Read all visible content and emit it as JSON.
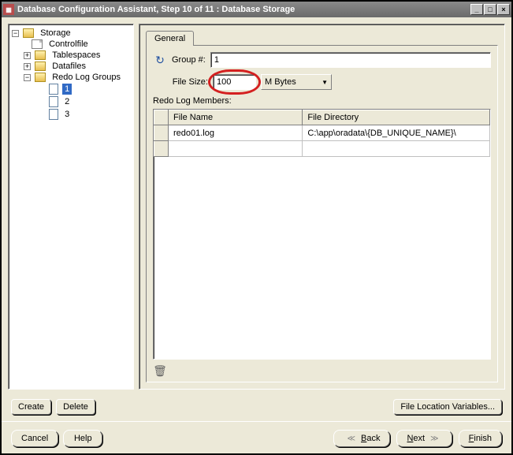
{
  "titlebar": {
    "text": "Database Configuration Assistant, Step 10 of 11 : Database Storage"
  },
  "tree": {
    "root": "Storage",
    "controlfile": "Controlfile",
    "tablespaces": "Tablespaces",
    "datafiles": "Datafiles",
    "redolog": "Redo Log Groups",
    "group1": "1",
    "group2": "2",
    "group3": "3"
  },
  "tabs": {
    "general": "General"
  },
  "form": {
    "group_label": "Group #:",
    "group_value": "1",
    "filesize_label": "File Size:",
    "filesize_value": "100",
    "filesize_unit": "M Bytes",
    "rlm_label": "Redo Log Members:"
  },
  "table": {
    "col_filename": "File Name",
    "col_filedir": "File Directory",
    "rows": [
      {
        "name": "redo01.log",
        "dir": "C:\\app\\oradata\\{DB_UNIQUE_NAME}\\"
      }
    ]
  },
  "buttons": {
    "create": "Create",
    "delete": "Delete",
    "filelocation": "File Location Variables...",
    "cancel": "Cancel",
    "help": "Help",
    "back": "Back",
    "next": "Next",
    "finish": "Finish"
  }
}
